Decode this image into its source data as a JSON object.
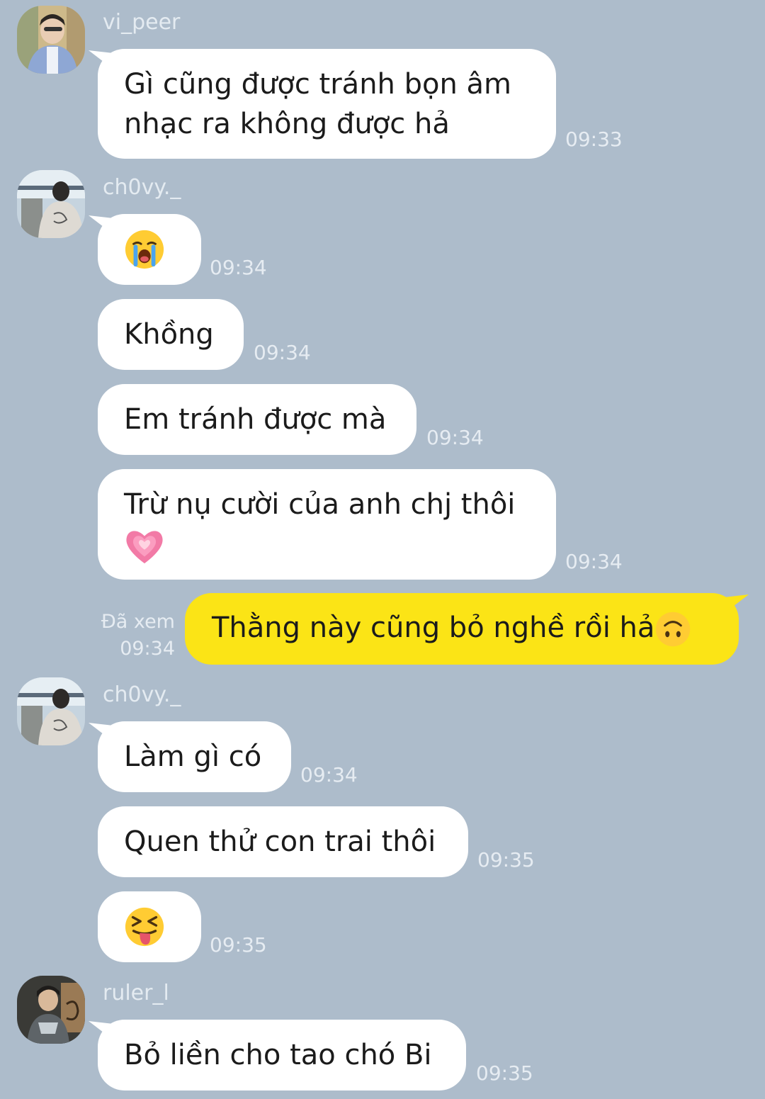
{
  "messages": [
    {
      "sender": "vi_peer",
      "text_lines": [
        "Gì cũng được tránh bọn âm",
        "nhạc ra không được hả"
      ],
      "time": "09:33"
    },
    {
      "sender": "ch0vy._",
      "emoji": "loudly-crying-face",
      "time": "09:34"
    },
    {
      "text": "Khồng",
      "time": "09:34"
    },
    {
      "text": "Em tránh được mà",
      "time": "09:34"
    },
    {
      "text_lines": [
        "Trừ nụ cười của anh chj thôi"
      ],
      "emoji": "growing-heart",
      "time": "09:34"
    },
    {
      "mine": true,
      "text": "Thằng này cũng bỏ nghề rồi hả",
      "emoji": "upside-down-face",
      "seen_label": "Đã xem",
      "time": "09:34"
    },
    {
      "sender": "ch0vy._",
      "text": "Làm gì có",
      "time": "09:34"
    },
    {
      "text": "Quen thử con trai thôi",
      "time": "09:35"
    },
    {
      "emoji": "squinting-face-with-tongue",
      "time": "09:35"
    },
    {
      "sender": "ruler_l",
      "text": "Bỏ liền cho tao chó Bi",
      "time": "09:35"
    }
  ],
  "colors": {
    "background": "#adbccb",
    "incoming_bubble": "#ffffff",
    "outgoing_bubble": "#fbe416",
    "meta_text": "#e6ecf2"
  }
}
